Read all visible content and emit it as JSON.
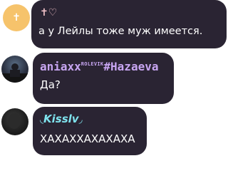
{
  "messages": [
    {
      "author": "✝♡",
      "author_color": "#f3c2c9",
      "text": "а у Лейлы тоже муж имеется."
    },
    {
      "author_main": "aniaxx",
      "author_sup": "ROLEVIK",
      "author_tag": "#Hazaeva",
      "author_color": "#c8a6f2",
      "text": "Да?"
    },
    {
      "author": "Kisslv",
      "author_color": "#7fe3ee",
      "text": "ХАХАХХАХАХАХА"
    }
  ]
}
